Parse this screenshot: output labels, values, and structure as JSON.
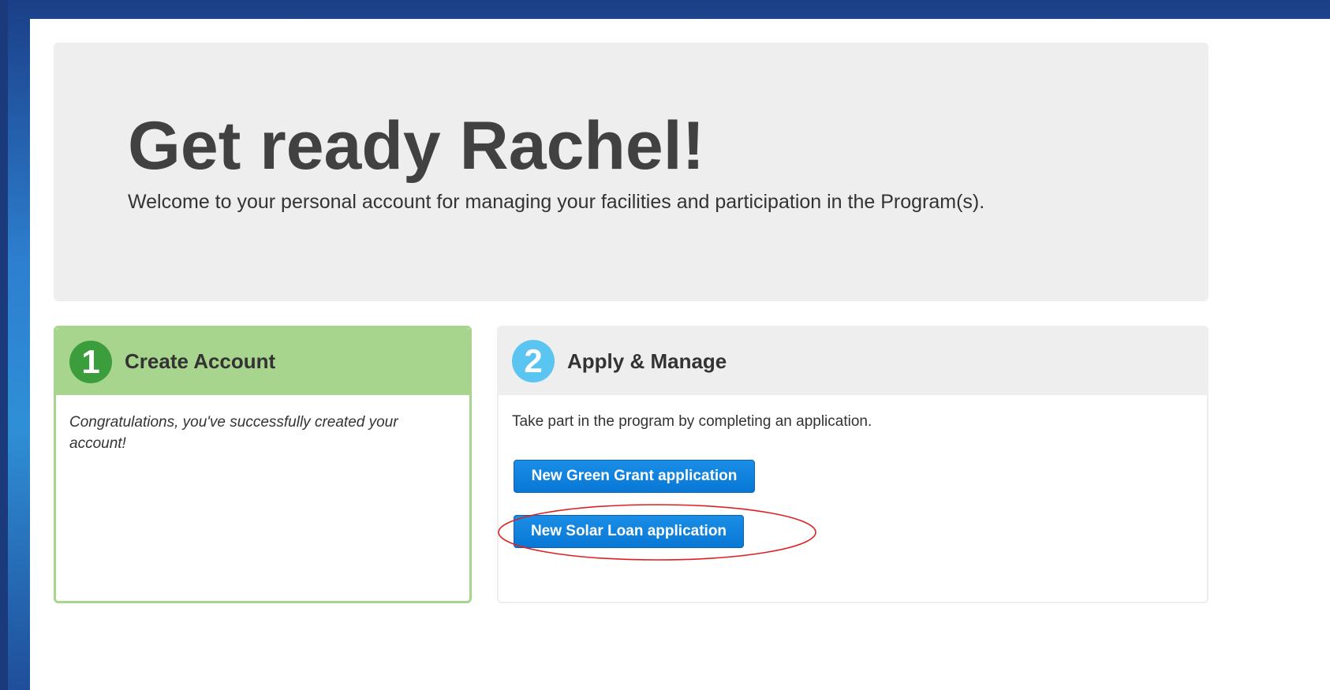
{
  "hero": {
    "title": "Get ready Rachel!",
    "subtitle": "Welcome to your personal account for managing your facilities and participation in the Program(s)."
  },
  "steps": [
    {
      "number": "1",
      "title": "Create Account",
      "body": "Congratulations, you've successfully created your account!",
      "status_color": "#a8d58e"
    },
    {
      "number": "2",
      "title": "Apply & Manage",
      "body": "Take part in the program by completing an application.",
      "buttons": [
        {
          "label": "New Green Grant application"
        },
        {
          "label": "New Solar Loan application"
        }
      ]
    }
  ],
  "colors": {
    "frame_blue": "#2d7fcf",
    "step1_green": "#a8d58e",
    "step1_circle": "#3c9d3c",
    "step2_circle": "#5bc5f2",
    "button_blue": "#0877d6",
    "annotation_red": "#e02020"
  },
  "annotation": {
    "shape": "ellipse",
    "highlights": "steps.1.buttons.1"
  }
}
